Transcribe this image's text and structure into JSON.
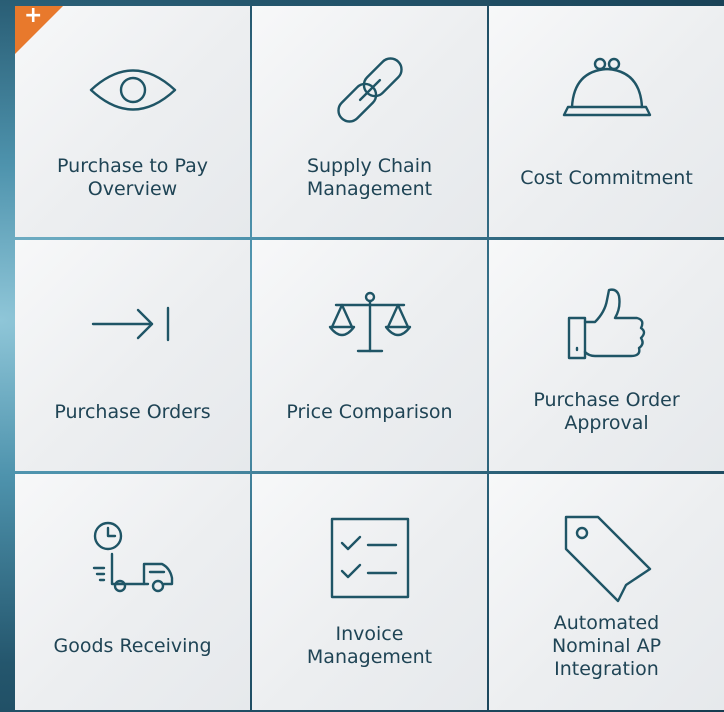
{
  "badge": {
    "symbol": "+",
    "color": "#e8792c"
  },
  "tiles": [
    {
      "label": "Purchase to Pay\nOverview",
      "icon": "eye-icon"
    },
    {
      "label": "Supply Chain\nManagement",
      "icon": "chain-link-icon"
    },
    {
      "label": "Cost Commitment",
      "icon": "purse-icon"
    },
    {
      "label": "Purchase Orders",
      "icon": "arrow-to-bar-icon"
    },
    {
      "label": "Price Comparison",
      "icon": "scales-icon"
    },
    {
      "label": "Purchase Order\nApproval",
      "icon": "thumbs-up-icon"
    },
    {
      "label": "Goods Receiving",
      "icon": "delivery-truck-clock-icon"
    },
    {
      "label": "Invoice\nManagement",
      "icon": "checklist-icon"
    },
    {
      "label": "Automated\nNominal AP\nIntegration",
      "icon": "price-tag-icon"
    }
  ]
}
